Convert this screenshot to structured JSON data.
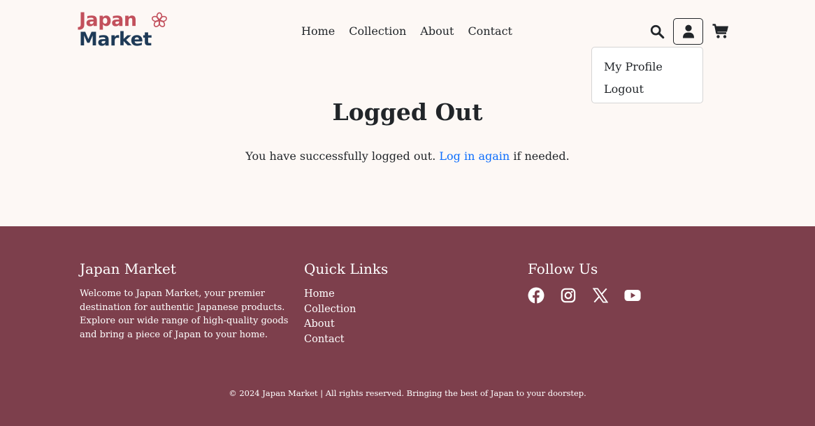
{
  "logo": {
    "line1": "Japan",
    "line2": "Market",
    "colors": {
      "primary": "#c2505c",
      "secondary": "#1e3a57"
    }
  },
  "nav": {
    "items": [
      {
        "label": "Home"
      },
      {
        "label": "Collection"
      },
      {
        "label": "About"
      },
      {
        "label": "Contact"
      }
    ]
  },
  "header_icons": {
    "search": "search-icon",
    "user": "user-icon",
    "cart": "cart-icon"
  },
  "user_menu": {
    "items": [
      {
        "label": "My Profile"
      },
      {
        "label": "Logout"
      }
    ]
  },
  "main": {
    "title": "Logged Out",
    "message_before": "You have successfully logged out. ",
    "link_text": "Log in again",
    "message_after": " if needed.",
    "link_color": "#0d6efd"
  },
  "footer": {
    "background": "#7d3f4c",
    "about": {
      "heading": "Japan Market",
      "text": "Welcome to Japan Market, your premier destination for authentic Japanese products. Explore our wide range of high-quality goods and bring a piece of Japan to your home."
    },
    "quick_links": {
      "heading": "Quick Links",
      "items": [
        "Home",
        "Collection",
        "About",
        "Contact"
      ]
    },
    "follow": {
      "heading": "Follow Us",
      "icons": [
        "facebook-icon",
        "instagram-icon",
        "x-twitter-icon",
        "youtube-icon"
      ]
    },
    "copyright": "© 2024 Japan Market | All rights reserved. Bringing the best of Japan to your doorstep."
  }
}
